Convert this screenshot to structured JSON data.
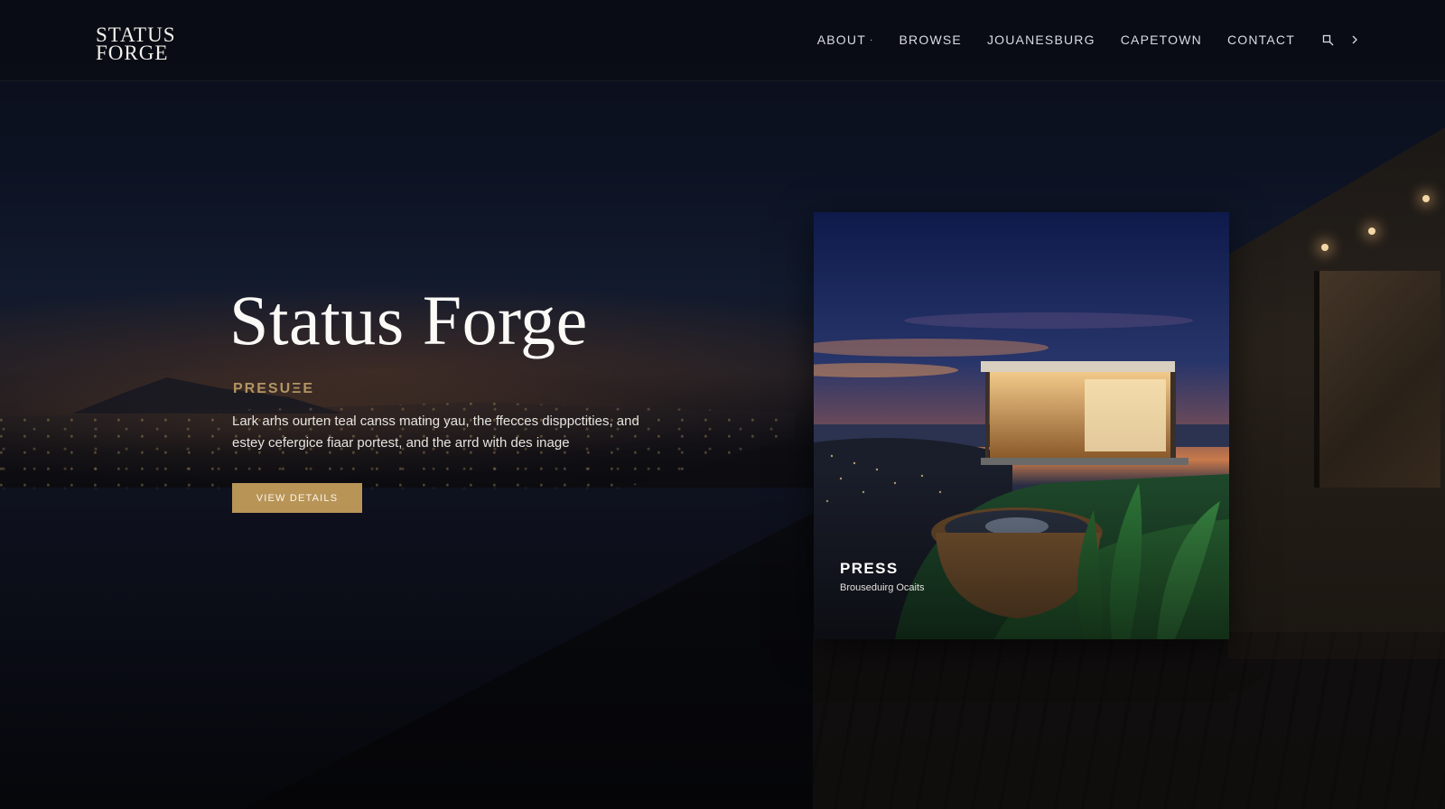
{
  "brand": {
    "line1": "STATUS",
    "line2": "FORGE"
  },
  "nav": {
    "items": [
      {
        "label": "ABOUT",
        "has_dropdown": true
      },
      {
        "label": "BROWSE"
      },
      {
        "label": "JOUANESBURG"
      },
      {
        "label": "CAPETOWN"
      },
      {
        "label": "CONTACT"
      }
    ],
    "icons": [
      "search-icon",
      "chevron-right-icon"
    ]
  },
  "hero": {
    "title": "Status Forge",
    "eyebrow": "PRESUΞE",
    "description": "Lark arhs ourten teal canss mating yau, the ffecces disppctities, and estey cefergice fiaar portest, and the arrd with des inage",
    "button_label": "VIEW DETAILS"
  },
  "card": {
    "label": "PRESS",
    "sub": "Brouseduirg Ocaits"
  },
  "colors": {
    "accent": "#b89457",
    "eyebrow": "#b39564",
    "background": "#07080d"
  }
}
